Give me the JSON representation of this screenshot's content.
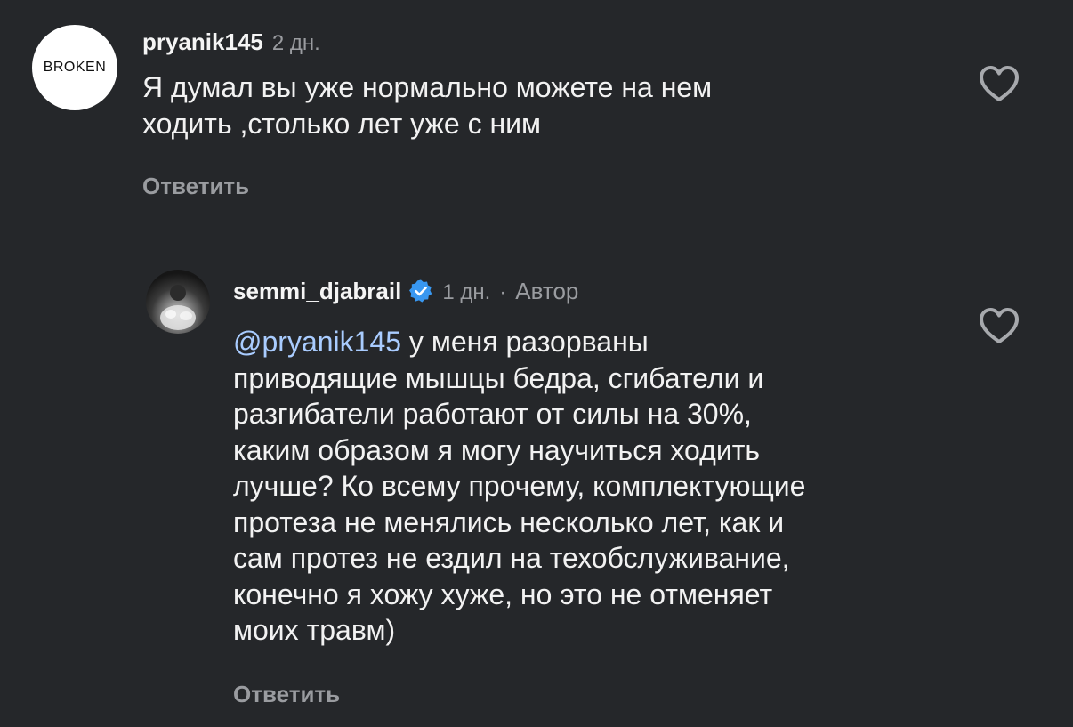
{
  "comments": [
    {
      "avatar_text": "BROKEN",
      "username": "pryanik145",
      "time": "2 дн.",
      "text": "Я думал вы уже нормально можете на нем\nходить ,столько лет уже с ним",
      "reply_label": "Ответить",
      "like_icon": "heart-outline-icon"
    },
    {
      "username": "semmi_djabrail",
      "verified_icon": "verified-badge-icon",
      "time": "1 дн.",
      "separator": "·",
      "author_label": "Автор",
      "mention": "@pryanik145",
      "text": " у меня разорваны\nприводящие мышцы бедра, сгибатели и\nразгибатели работают от силы на 30%,\nкаким образом я могу научиться ходить\nлучше? Ко всему прочему, комплектующие\nпротеза не менялись несколько лет, как и\nсам протез не ездил на техобслуживание,\nконечно я хожу хуже, но это не отменяет\nмоих травм)",
      "reply_label": "Ответить",
      "like_icon": "heart-outline-icon"
    }
  ],
  "colors": {
    "background": "#25272a",
    "text": "#f2f2f2",
    "muted": "#9a9ca0",
    "mention": "#a9ccff",
    "verified": "#3897f0"
  }
}
